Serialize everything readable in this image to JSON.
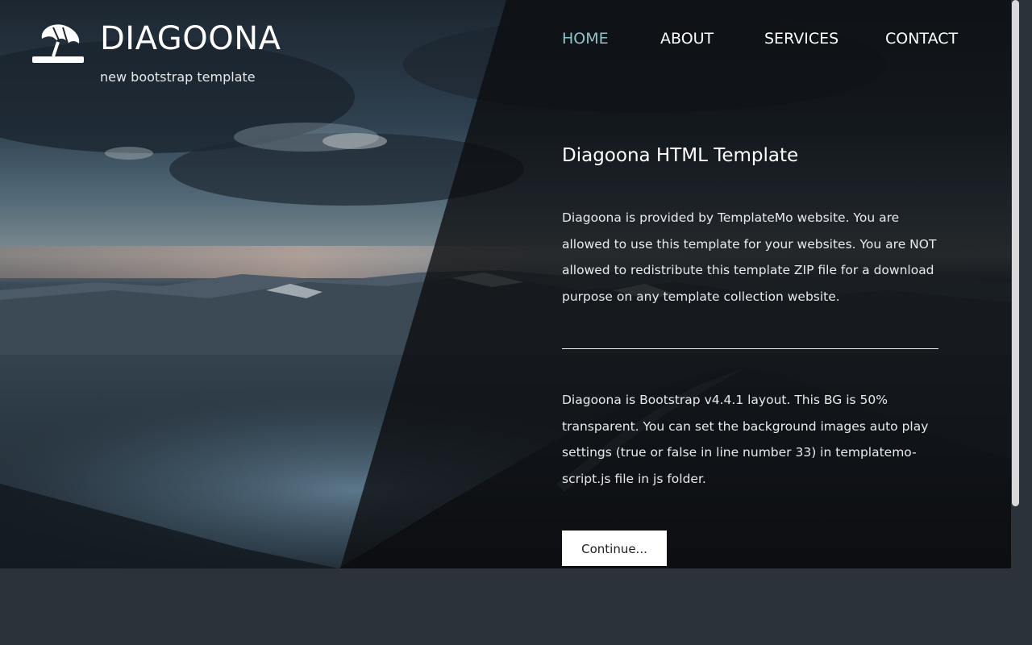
{
  "brand": {
    "title": "DIAGOONA",
    "tagline": "new bootstrap template",
    "logo_icon": "umbrella-icon"
  },
  "nav": {
    "items": [
      {
        "label": "HOME",
        "active": true
      },
      {
        "label": "ABOUT",
        "active": false
      },
      {
        "label": "SERVICES",
        "active": false
      },
      {
        "label": "CONTACT",
        "active": false
      }
    ]
  },
  "content": {
    "heading": "Diagoona HTML Template",
    "paragraph1": "Diagoona is provided by TemplateMo website. You are allowed to use this template for your websites. You are NOT allowed to redistribute this template ZIP file for a download purpose on any template collection website.",
    "paragraph2": "Diagoona is Bootstrap v4.4.1 layout. This BG is 50% transparent. You can set the background images auto play settings (true or false in line number 33) in templatemo-script.js file in js folder.",
    "button_label": "Continue..."
  },
  "colors": {
    "page_bg": "#2c323a",
    "nav_active": "#8cc4cb",
    "text": "#ffffff",
    "button_bg": "#ffffff"
  }
}
